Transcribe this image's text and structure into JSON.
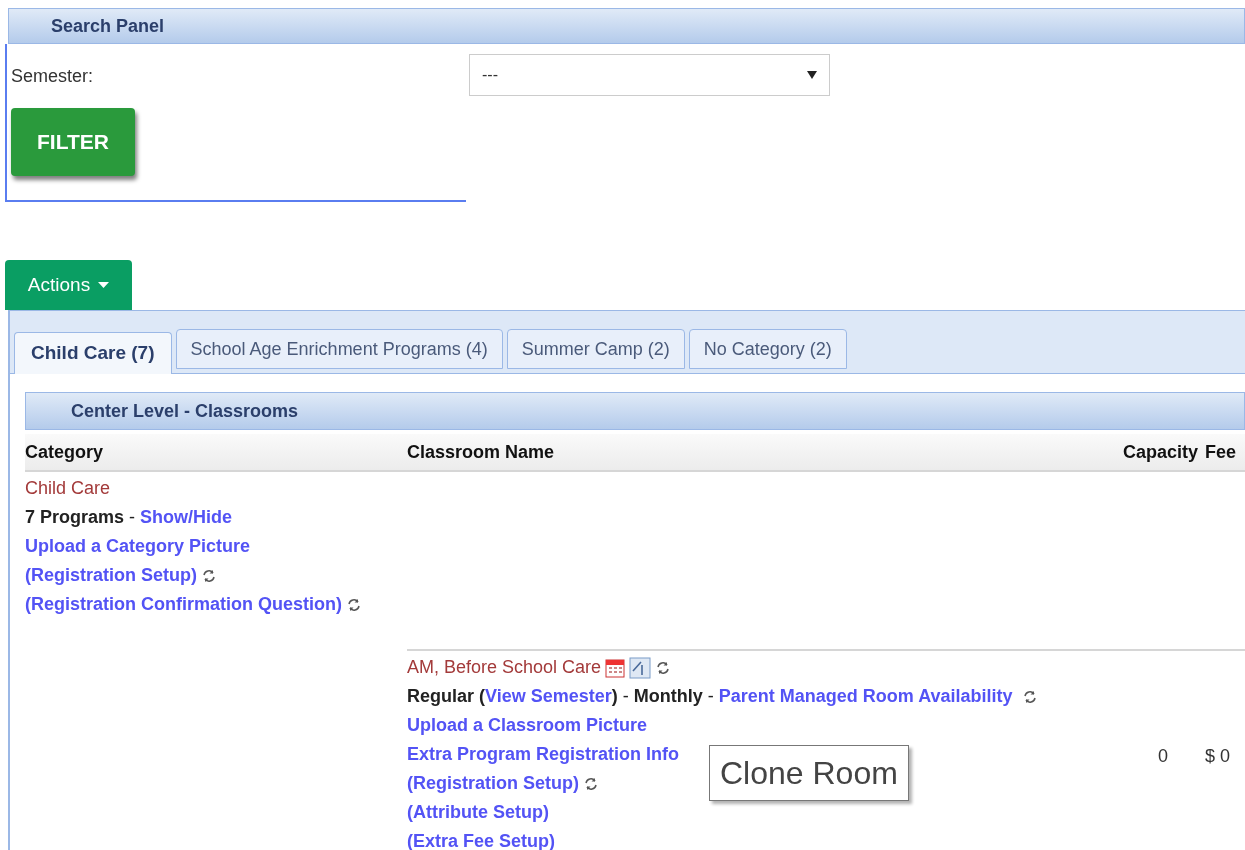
{
  "search_panel": {
    "title": "Search Panel",
    "semester_label": "Semester:",
    "semester_value": "---",
    "filter_button": "FILTER"
  },
  "actions_button": "Actions",
  "tabs": [
    {
      "label": "Child Care (7)",
      "selected": true
    },
    {
      "label": "School Age Enrichment Programs (4)",
      "selected": false
    },
    {
      "label": "Summer Camp (2)",
      "selected": false
    },
    {
      "label": "No Category (2)",
      "selected": false
    }
  ],
  "section": {
    "title": "Center Level - Classrooms",
    "columns": [
      "Category",
      "Classroom Name",
      "Capacity",
      "Fee"
    ],
    "category": {
      "name": "Child Care",
      "count": "7 Programs",
      "separator": "-",
      "show_hide": "Show/Hide",
      "links": [
        {
          "label": "Upload a Category Picture",
          "refresh": false
        },
        {
          "label": "(Registration Setup)",
          "refresh": true
        },
        {
          "label": "(Registration Confirmation Question)",
          "refresh": true
        }
      ]
    },
    "classroom": {
      "name": "AM, Before School Care",
      "type": "Regular",
      "open_paren": "(",
      "view_semester": "View Semester",
      "close_paren": ")",
      "dash1": "-",
      "billing": "Monthly",
      "dash2": "-",
      "availability": "Parent Managed Room Availability",
      "capacity": "0",
      "fee": "$ 0",
      "links": [
        {
          "label": "Upload a Classroom Picture",
          "refresh": false
        },
        {
          "label": "Extra Program Registration Info",
          "refresh": false
        },
        {
          "label": "(Registration Setup)",
          "refresh": true
        },
        {
          "label": "(Attribute Setup)",
          "refresh": false
        },
        {
          "label": "(Extra Fee Setup)",
          "refresh": false
        }
      ]
    }
  },
  "tooltip": "Clone Room"
}
